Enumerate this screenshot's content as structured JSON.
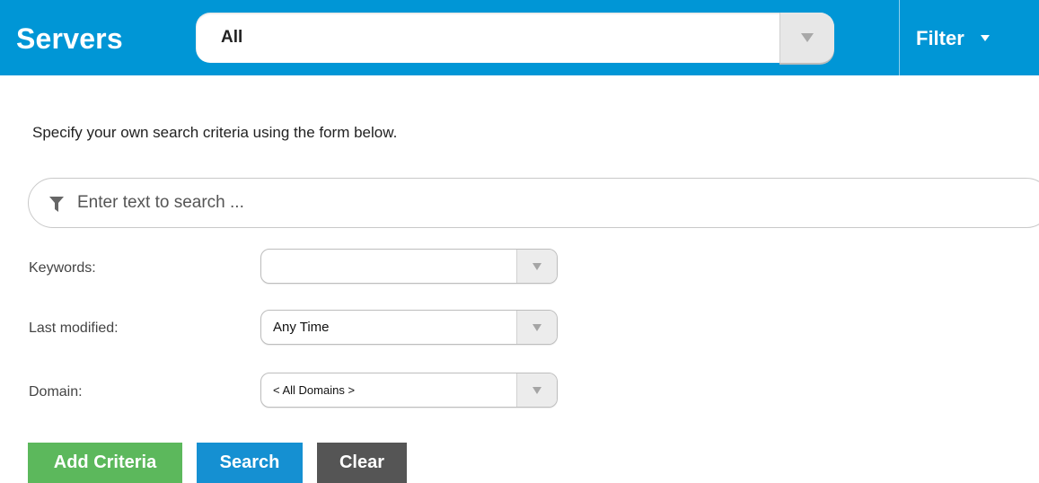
{
  "header": {
    "title": "Servers",
    "view_select": {
      "value": "All",
      "icon": "chevron-down-icon"
    },
    "filter_label": "Filter",
    "filter_icon": "caret-down-icon"
  },
  "form": {
    "intro": "Specify your own search criteria using the form below.",
    "search": {
      "placeholder": "Enter text to search ...",
      "value": "",
      "icon": "filter-funnel-icon"
    },
    "fields": [
      {
        "label": "Keywords:",
        "value": ""
      },
      {
        "label": "Last modified:",
        "value": "Any Time"
      },
      {
        "label": "Domain:",
        "value": "< All Domains >"
      }
    ]
  },
  "buttons": {
    "add_criteria": "Add Criteria",
    "search": "Search",
    "clear": "Clear"
  },
  "colors": {
    "header_bg": "#0096d6",
    "add_button": "#5cb85c",
    "search_button": "#1590d2",
    "clear_button": "#555555"
  }
}
